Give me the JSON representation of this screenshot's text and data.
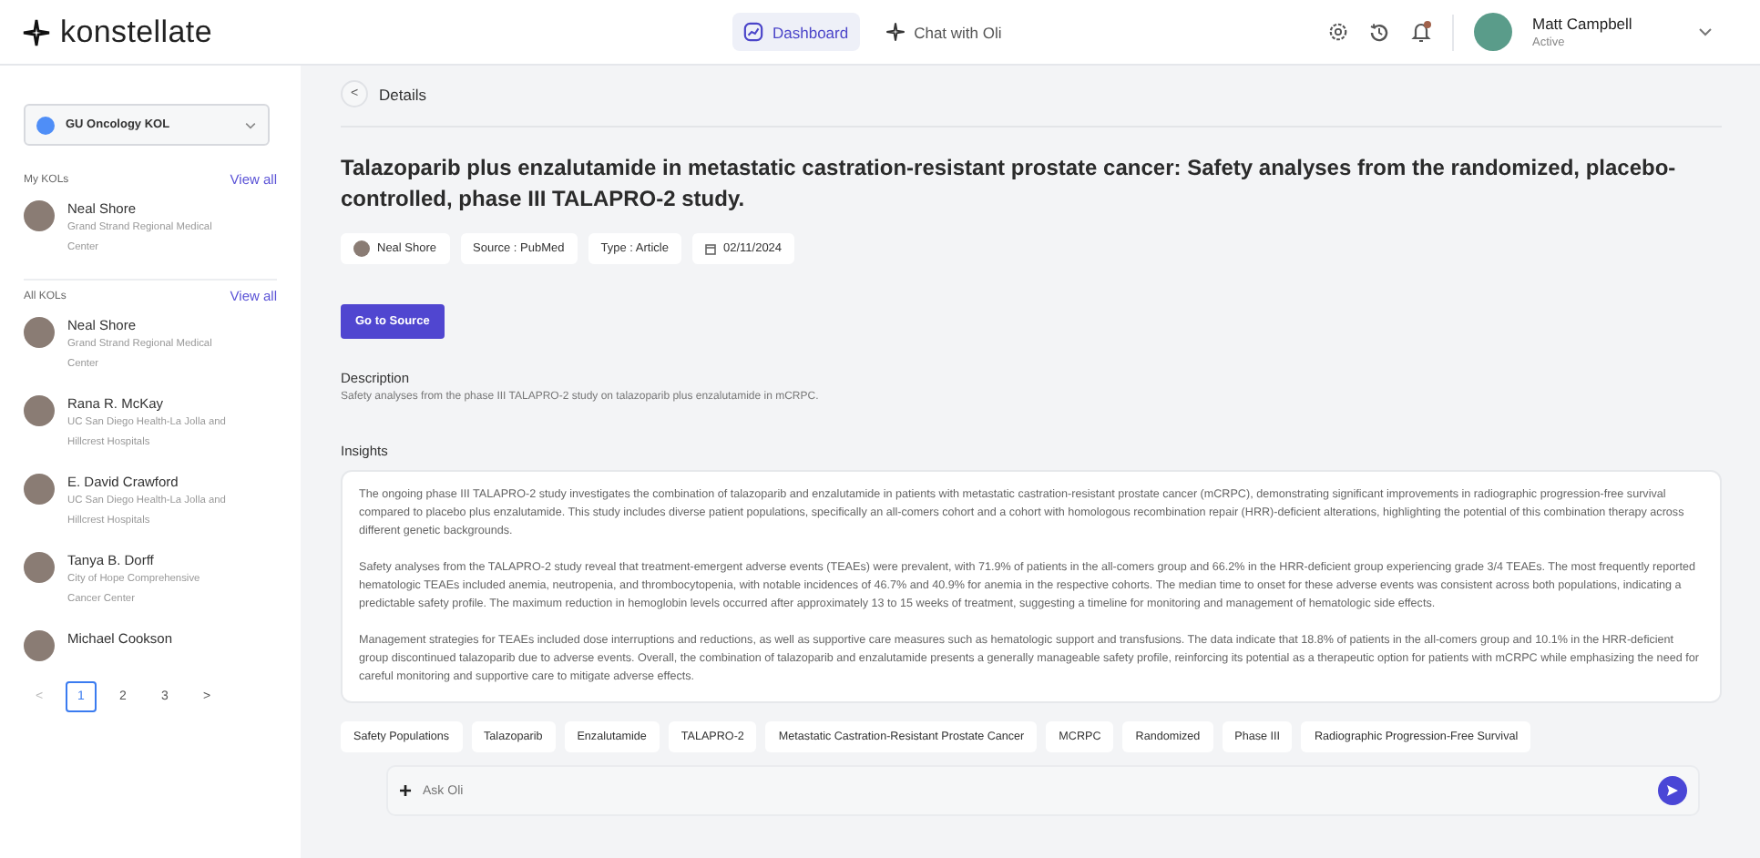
{
  "header": {
    "logo": "konstellate",
    "nav": [
      {
        "label": "Dashboard",
        "selected": true,
        "kind": "dashboard"
      },
      {
        "label": "Chat with Oli",
        "selected": false,
        "kind": "chat"
      }
    ],
    "notification_unread": true,
    "user": {
      "name": "Matt Campbell",
      "status": "Active"
    }
  },
  "sidebar": {
    "group_select": {
      "value": "GU Oncology KOL",
      "color": "#4f8ef7"
    },
    "sections": [
      {
        "title": "My KOLs",
        "link": "View all",
        "people": [
          {
            "name": "Neal Shore",
            "affiliation": "Grand Strand Regional Medical Center"
          }
        ]
      },
      {
        "title": "All KOLs",
        "link": "View all",
        "people": [
          {
            "name": "Neal Shore",
            "affiliation": "Grand Strand Regional Medical Center"
          },
          {
            "name": "Rana R. McKay",
            "affiliation": "UC San Diego Health-La Jolla and Hillcrest Hospitals"
          },
          {
            "name": "E. David Crawford",
            "affiliation": "UC San Diego Health-La Jolla and Hillcrest Hospitals"
          },
          {
            "name": "Tanya B. Dorff",
            "affiliation": "City of Hope Comprehensive Cancer Center"
          },
          {
            "name": "Michael Cookson"
          }
        ]
      }
    ],
    "pagination": {
      "prev": "<",
      "next": ">",
      "pages": [
        {
          "label": "1",
          "selected": true
        },
        {
          "label": "2",
          "selected": false
        },
        {
          "label": "3",
          "selected": false
        }
      ]
    }
  },
  "details": {
    "back": "<",
    "heading": "Details",
    "title": "Talazoparib plus enzalutamide in metastatic castration-resistant prostate cancer: Safety analyses from the randomized, placebo-controlled, phase III TALAPRO-2 study.",
    "meta": [
      {
        "kind": "author",
        "text": "Neal Shore"
      },
      {
        "kind": "plain",
        "text": "Source : PubMed"
      },
      {
        "kind": "plain",
        "text": "Type : Article"
      },
      {
        "kind": "date",
        "text": "02/11/2024"
      }
    ],
    "source_button": "Go to Source",
    "description_label": "Description",
    "description": "Safety analyses from the phase III TALAPRO-2 study on talazoparib plus enzalutamide in mCRPC.",
    "insights_label": "Insights",
    "insights": [
      "The ongoing phase III TALAPRO-2 study investigates the combination of talazoparib and enzalutamide in patients with metastatic castration-resistant prostate cancer (mCRPC), demonstrating significant improvements in radiographic progression-free survival compared to placebo plus enzalutamide. This study includes diverse patient populations, specifically an all-comers cohort and a cohort with homologous recombination repair (HRR)-deficient alterations, highlighting the potential of this combination therapy across different genetic backgrounds.",
      "Safety analyses from the TALAPRO-2 study reveal that treatment-emergent adverse events (TEAEs) were prevalent, with 71.9% of patients in the all-comers group and 66.2% in the HRR-deficient group experiencing grade 3/4 TEAEs. The most frequently reported hematologic TEAEs included anemia, neutropenia, and thrombocytopenia, with notable incidences of 46.7% and 40.9% for anemia in the respective cohorts. The median time to onset for these adverse events was consistent across both populations, indicating a predictable safety profile. The maximum reduction in hemoglobin levels occurred after approximately 13 to 15 weeks of treatment, suggesting a timeline for monitoring and management of hematologic side effects.",
      "Management strategies for TEAEs included dose interruptions and reductions, as well as supportive care measures such as hematologic support and transfusions. The data indicate that 18.8% of patients in the all-comers group and 10.1% in the HRR-deficient group discontinued talazoparib due to adverse events. Overall, the combination of talazoparib and enzalutamide presents a generally manageable safety profile, reinforcing its potential as a therapeutic option for patients with mCRPC while emphasizing the need for careful monitoring and supportive care to mitigate adverse effects."
    ],
    "tags": [
      "Safety Populations",
      "Talazoparib",
      "Enzalutamide",
      "TALAPRO-2",
      "Metastatic Castration-Resistant Prostate Cancer",
      "MCRPC",
      "Randomized",
      "Phase III",
      "Radiographic Progression-Free Survival"
    ],
    "chat": {
      "plus": "+",
      "placeholder": "Ask Oli"
    }
  }
}
